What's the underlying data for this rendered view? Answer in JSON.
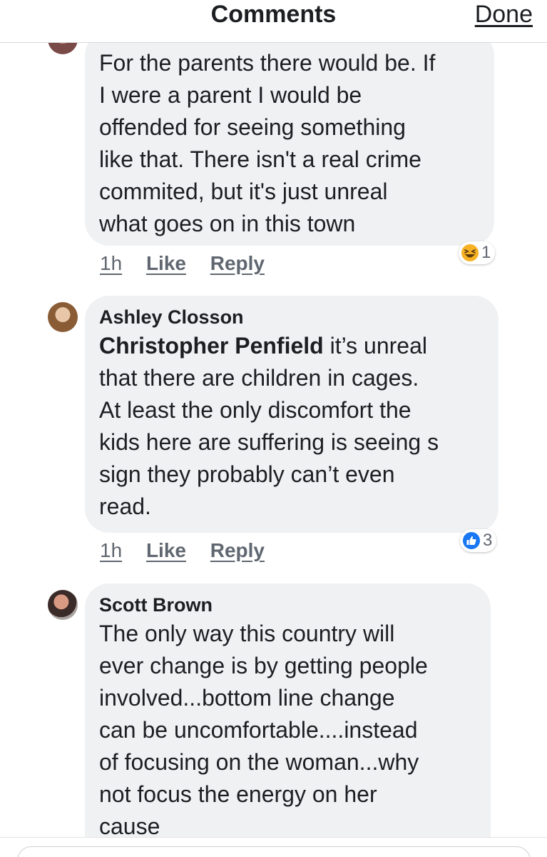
{
  "header": {
    "title": "Comments",
    "done_label": "Done"
  },
  "comments": [
    {
      "author": "",
      "lines": [
        "For the parents there would be. If",
        "I were a parent I would be",
        "offended for seeing something",
        "like that. There isn't a real crime",
        "commited,  but it's just unreal",
        "what goes on in this town"
      ],
      "time": "1h",
      "like_label": "Like",
      "reply_label": "Reply",
      "reaction": {
        "icon": "haha-icon",
        "count": "1",
        "color": "#f7b125"
      }
    },
    {
      "author": "Ashley Closson",
      "mention": "Christopher Penfield",
      "first_line_rest": " it’s unreal",
      "lines": [
        "that there are children in cages.",
        "At least the only discomfort the",
        "kids here are suffering is seeing s",
        "sign they probably can’t even",
        "read."
      ],
      "time": "1h",
      "like_label": "Like",
      "reply_label": "Reply",
      "reaction": {
        "icon": "like-icon",
        "count": "3",
        "color": "#1877f2"
      }
    },
    {
      "author": "Scott Brown",
      "lines": [
        "The only way this country will",
        "ever change is by getting people",
        "involved...bottom line change",
        "can be uncomfortable....instead",
        "of focusing on the woman...why",
        "not focus the energy on her",
        "cause"
      ]
    }
  ]
}
